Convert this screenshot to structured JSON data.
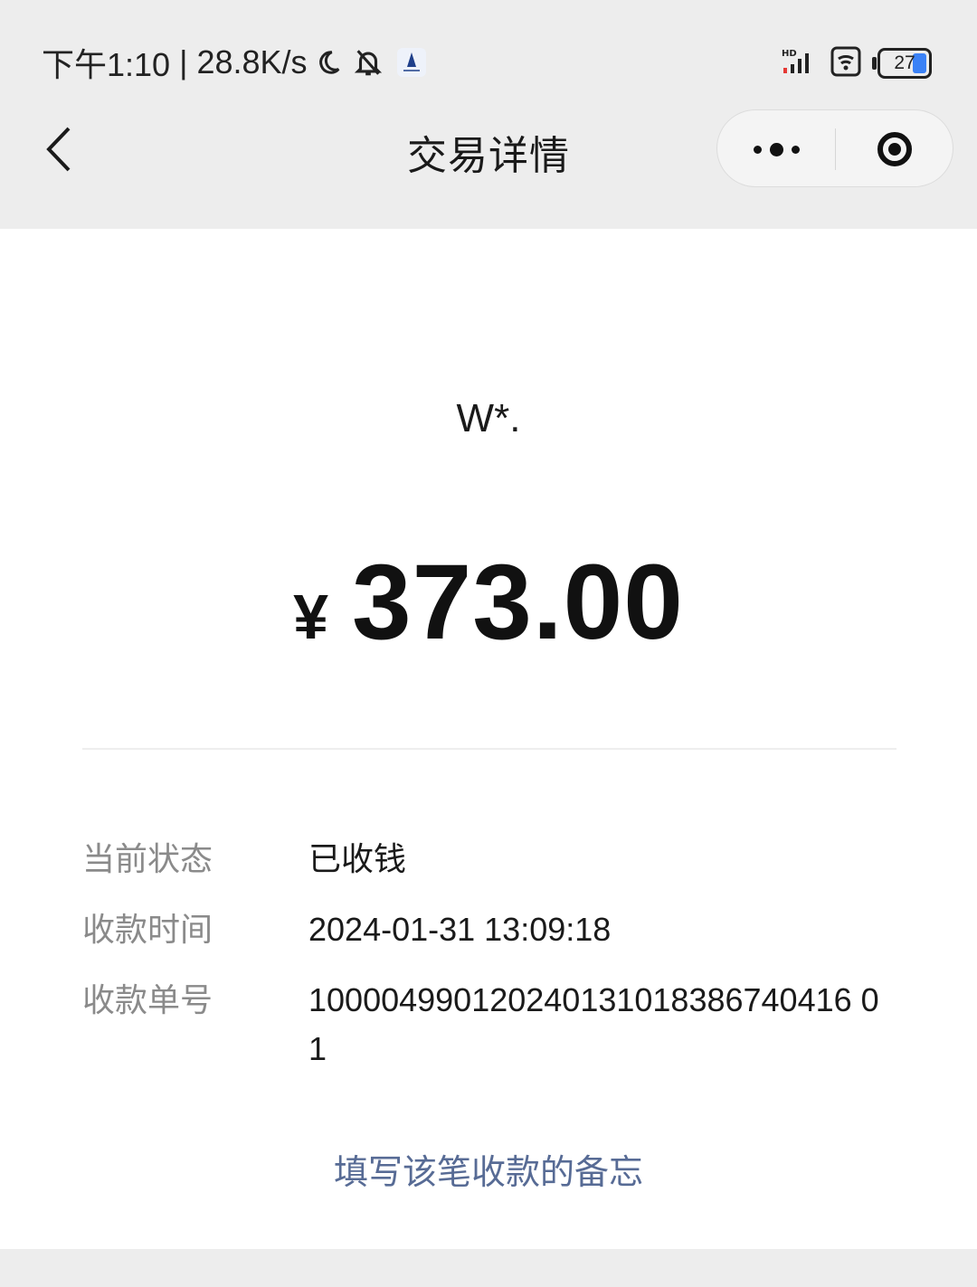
{
  "status_bar": {
    "time": "下午1:10",
    "separator": "|",
    "network_speed": "28.8K/s",
    "battery_level": "27",
    "icons": [
      "moon-icon",
      "bell-off-icon",
      "app-notification-icon",
      "hd-signal-icon",
      "wifi-icon",
      "battery-icon"
    ]
  },
  "nav": {
    "title": "交易详情",
    "back_icon": "chevron-left-icon",
    "more_icon": "more-dots-icon",
    "close_icon": "target-close-icon"
  },
  "transaction": {
    "payer": "W*.",
    "currency_symbol": "¥",
    "amount": "373.00",
    "details": [
      {
        "label": "当前状态",
        "value": "已收钱"
      },
      {
        "label": "收款时间",
        "value": "2024-01-31 13:09:18"
      },
      {
        "label": "收款单号",
        "value": "100004990120240131018386740416 01"
      }
    ],
    "memo_link": "填写该笔收款的备忘"
  },
  "colors": {
    "background": "#ededed",
    "card": "#ffffff",
    "link": "#576b95",
    "label": "#8a8a8a",
    "battery_fill": "#3b82f6"
  }
}
